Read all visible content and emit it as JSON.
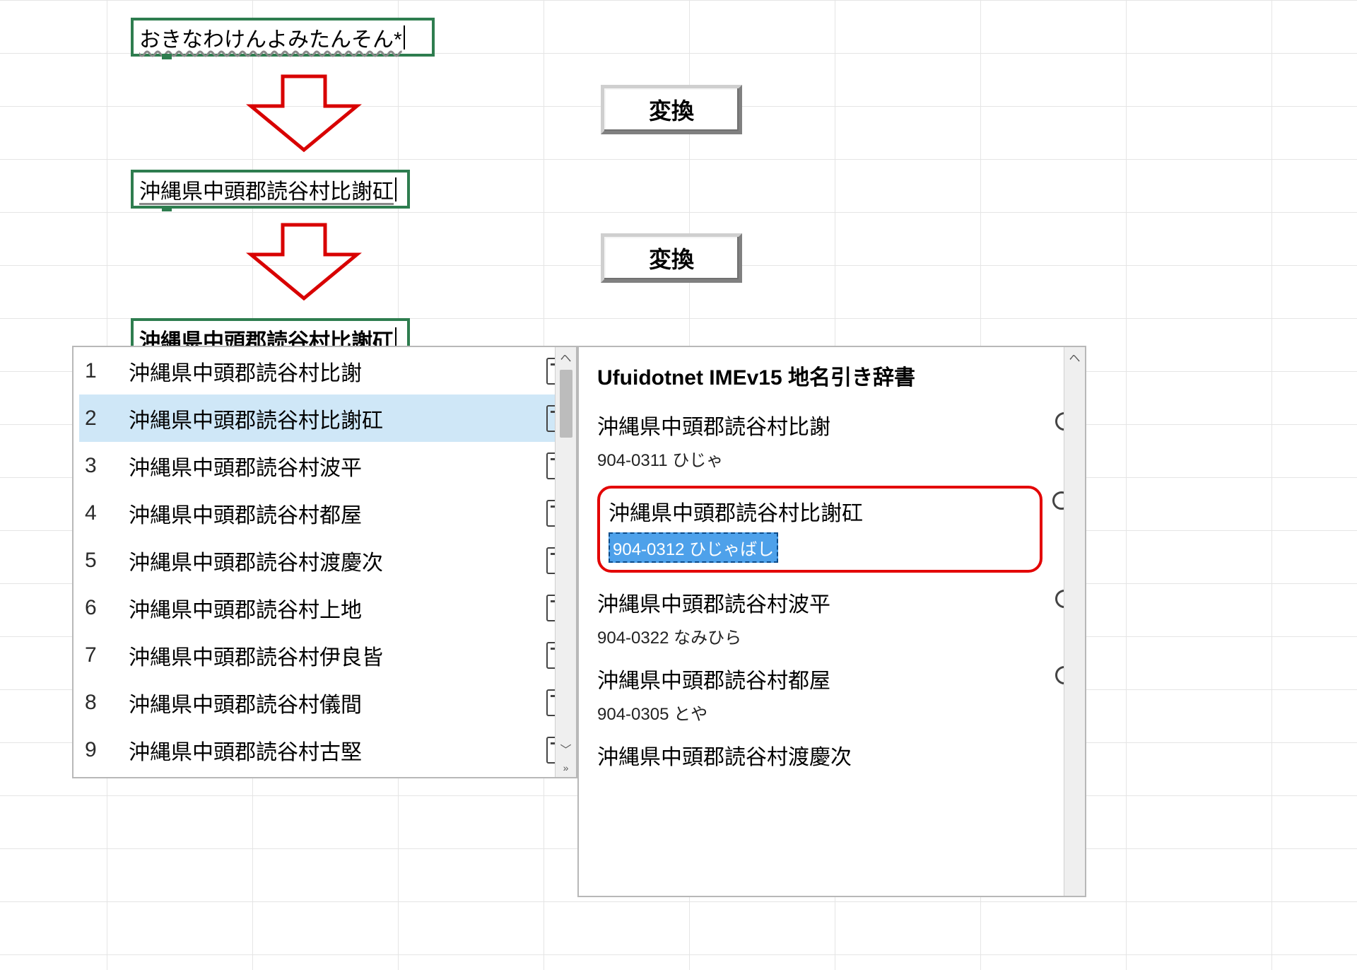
{
  "cells": {
    "input_hiragana": "おきなわけんよみたんそん*",
    "converted_1": "沖縄県中頭郡読谷村比謝矼",
    "converted_2": "沖縄県中頭郡読谷村比謝矼"
  },
  "buttons": {
    "henkan": "変換"
  },
  "candidates": [
    {
      "num": "1",
      "text": "沖縄県中頭郡読谷村比謝"
    },
    {
      "num": "2",
      "text": "沖縄県中頭郡読谷村比謝矼"
    },
    {
      "num": "3",
      "text": "沖縄県中頭郡読谷村波平"
    },
    {
      "num": "4",
      "text": "沖縄県中頭郡読谷村都屋"
    },
    {
      "num": "5",
      "text": "沖縄県中頭郡読谷村渡慶次"
    },
    {
      "num": "6",
      "text": "沖縄県中頭郡読谷村上地"
    },
    {
      "num": "7",
      "text": "沖縄県中頭郡読谷村伊良皆"
    },
    {
      "num": "8",
      "text": "沖縄県中頭郡読谷村儀間"
    },
    {
      "num": "9",
      "text": "沖縄県中頭郡読谷村古堅"
    }
  ],
  "selected_candidate_index": 1,
  "detail": {
    "title": "Ufuidotnet IMEv15 地名引き辞書",
    "items": [
      {
        "place": "沖縄県中頭郡読谷村比謝",
        "reading": "904-0311 ひじゃ",
        "highlight": false
      },
      {
        "place": "沖縄県中頭郡読谷村比謝矼",
        "reading": "904-0312 ひじゃばし",
        "highlight": true
      },
      {
        "place": "沖縄県中頭郡読谷村波平",
        "reading": "904-0322 なみひら",
        "highlight": false
      },
      {
        "place": "沖縄県中頭郡読谷村都屋",
        "reading": "904-0305 とや",
        "highlight": false
      },
      {
        "place": "沖縄県中頭郡読谷村渡慶次",
        "reading": "",
        "highlight": false
      }
    ]
  }
}
